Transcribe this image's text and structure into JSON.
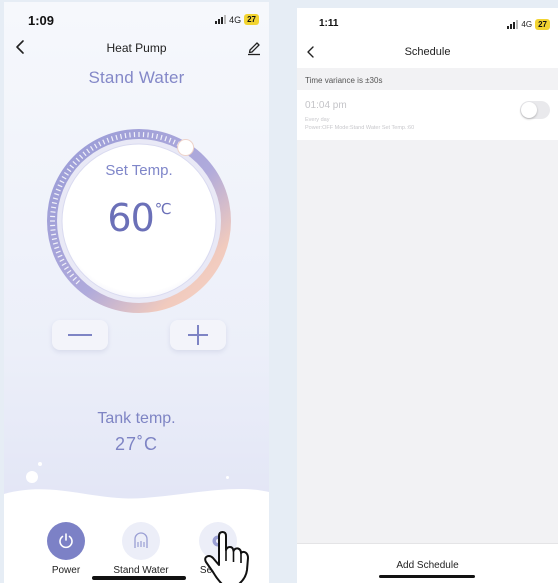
{
  "left_screen": {
    "status": {
      "time": "1:09",
      "network": "4G",
      "battery": "27"
    },
    "nav": {
      "title": "Heat Pump",
      "back_icon": "chevron-left-icon",
      "edit_icon": "pencil-icon"
    },
    "mode_title": "Stand Water",
    "dial": {
      "label": "Set Temp.",
      "value": "60",
      "unit": "℃",
      "level_fraction": 0.62
    },
    "buttons": {
      "minus": "—",
      "plus": "+"
    },
    "tank": {
      "label": "Tank temp.",
      "value": "27˚C"
    },
    "tabs": [
      {
        "label": "Power",
        "icon": "power-icon"
      },
      {
        "label": "Stand Water",
        "icon": "water-heater-icon"
      },
      {
        "label": "Settings",
        "icon": "gear-icon"
      }
    ],
    "colors": {
      "accent": "#7c81c6",
      "text_accent": "#8488c8"
    }
  },
  "right_screen": {
    "status": {
      "time": "1:11",
      "network": "4G",
      "battery": "27"
    },
    "nav": {
      "title": "Schedule",
      "back_icon": "chevron-left-icon"
    },
    "variance": "Time variance is  ±30s",
    "schedule": {
      "time": "01:04 pm",
      "days": "Every day",
      "detail": "Power:OFF Mode:Stand Water Set Temp.:60",
      "enabled": false
    },
    "footer": {
      "add_label": "Add Schedule"
    }
  }
}
